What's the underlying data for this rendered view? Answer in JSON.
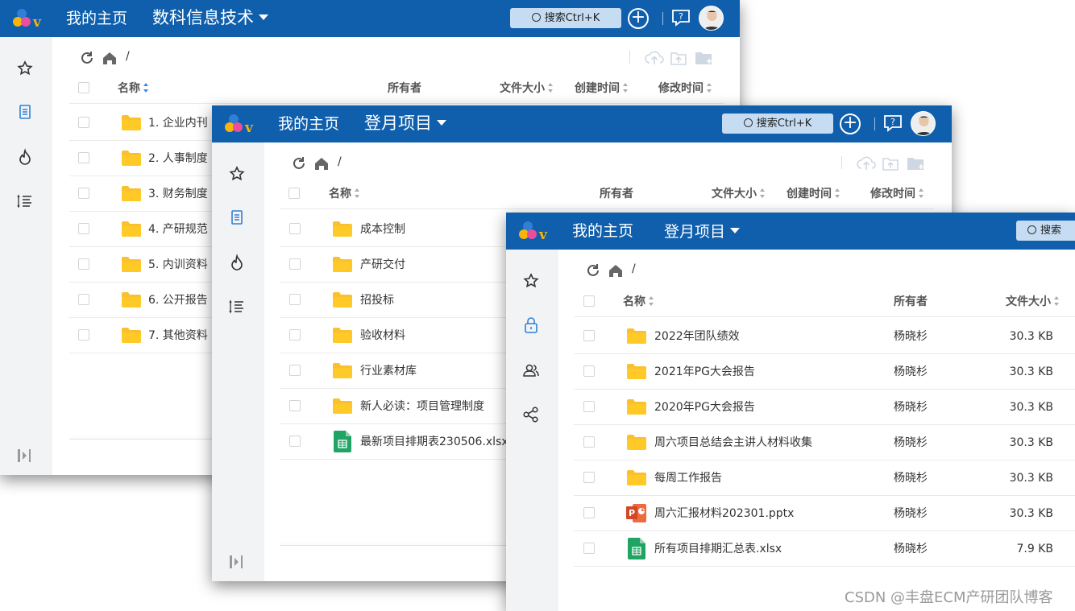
{
  "brand": {
    "logo_letter": "v",
    "colors": {
      "header": "#0f5fad",
      "blue": "#2f7fd6",
      "yellow": "#f8b30c",
      "pink": "#e84f9c",
      "folder": "#fbc02d"
    }
  },
  "common": {
    "home_label": "我的主页",
    "search_label": "搜索Ctrl+K",
    "search_label_cut": "搜索",
    "breadcrumb": "/",
    "columns": {
      "name": "名称",
      "owner": "所有者",
      "size": "文件大小",
      "created": "创建时间",
      "modified": "修改时间"
    }
  },
  "window1": {
    "space_title": "数科信息技术",
    "sidebar": [
      "star-icon",
      "document-icon",
      "fire-icon",
      "list-icon"
    ],
    "rows": [
      {
        "name": "1. 企业内刊",
        "type": "folder"
      },
      {
        "name": "2. 人事制度",
        "type": "folder"
      },
      {
        "name": "3. 财务制度",
        "type": "folder"
      },
      {
        "name": "4. 产研规范",
        "type": "folder"
      },
      {
        "name": "5. 内训资料",
        "type": "folder"
      },
      {
        "name": "6. 公开报告",
        "type": "folder"
      },
      {
        "name": "7. 其他资料",
        "type": "folder"
      }
    ]
  },
  "window2": {
    "space_title": "登月项目",
    "sidebar": [
      "star-icon",
      "document-icon",
      "fire-icon",
      "list-icon"
    ],
    "rows": [
      {
        "name": "成本控制",
        "type": "folder"
      },
      {
        "name": "产研交付",
        "type": "folder"
      },
      {
        "name": "招投标",
        "type": "folder"
      },
      {
        "name": "验收材料",
        "type": "folder"
      },
      {
        "name": "行业素材库",
        "type": "folder"
      },
      {
        "name": "新人必读：项目管理制度",
        "type": "folder"
      },
      {
        "name": "最新项目排期表230506.xlsx",
        "type": "xlsx"
      }
    ]
  },
  "window3": {
    "space_title": "登月项目",
    "sidebar": [
      "star-icon",
      "lock-icon",
      "users-icon",
      "share-icon"
    ],
    "rows": [
      {
        "name": "2022年团队绩效",
        "type": "folder",
        "owner": "杨晓杉",
        "size": "30.3 KB"
      },
      {
        "name": "2021年PG大会报告",
        "type": "folder",
        "owner": "杨晓杉",
        "size": "30.3 KB"
      },
      {
        "name": "2020年PG大会报告",
        "type": "folder",
        "owner": "杨晓杉",
        "size": "30.3 KB"
      },
      {
        "name": "周六项目总结会主讲人材料收集",
        "type": "folder",
        "owner": "杨晓杉",
        "size": "30.3 KB"
      },
      {
        "name": "每周工作报告",
        "type": "folder",
        "owner": "杨晓杉",
        "size": "30.3 KB"
      },
      {
        "name": "周六汇报材料202301.pptx",
        "type": "pptx",
        "owner": "杨晓杉",
        "size": "30.3 KB"
      },
      {
        "name": "所有项目排期汇总表.xlsx",
        "type": "xlsx",
        "owner": "杨晓杉",
        "size": "7.9 KB"
      }
    ]
  },
  "watermark": "CSDN @丰盘ECM产研团队博客"
}
